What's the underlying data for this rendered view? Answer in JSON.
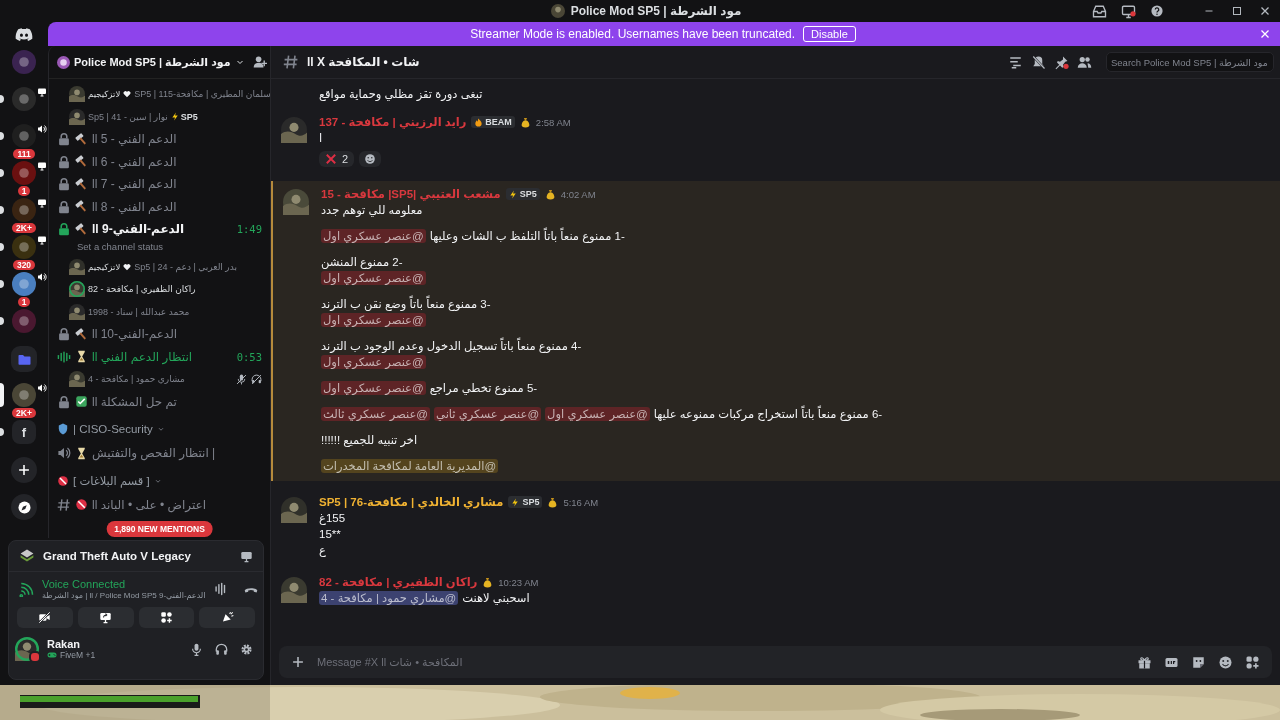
{
  "title_bar": {
    "title": "Police Mod SP5 | مود الشرطة"
  },
  "banner": {
    "text": "Streamer Mode is enabled. Usernames have been truncated.",
    "button": "Disable"
  },
  "rail": {
    "servers": [
      {
        "kind": "server",
        "color": "#3a2350",
        "unread": false,
        "selected": false,
        "voice": false,
        "screen": false
      },
      {
        "kind": "server",
        "color": "#2a2a2a",
        "unread": true,
        "selected": false,
        "voice": false,
        "screen": true
      },
      {
        "kind": "server",
        "color": "#1f1f1f",
        "unread": true,
        "selected": false,
        "voice": true,
        "screen": false,
        "badge": "111"
      },
      {
        "kind": "server",
        "color": "#6a1010",
        "unread": true,
        "selected": false,
        "voice": false,
        "screen": true,
        "badge": "1"
      },
      {
        "kind": "server",
        "color": "#3a2412",
        "unread": true,
        "selected": false,
        "voice": false,
        "screen": true,
        "badge": "2K+"
      },
      {
        "kind": "server",
        "color": "#3a3010",
        "unread": true,
        "selected": false,
        "voice": false,
        "screen": true,
        "badge": "320"
      },
      {
        "kind": "server",
        "color": "#4a7fc0",
        "unread": true,
        "selected": false,
        "voice": true,
        "screen": false,
        "badge": "1"
      },
      {
        "kind": "server",
        "color": "#4a1830",
        "unread": true,
        "selected": false,
        "voice": false,
        "screen": false
      },
      {
        "kind": "folder"
      },
      {
        "kind": "server",
        "color": "#4a4636",
        "unread": false,
        "selected": true,
        "voice": true,
        "screen": false,
        "badge": "2K+"
      },
      {
        "kind": "server",
        "color": "#232428",
        "unread": true,
        "selected": false,
        "voice": false,
        "screen": false,
        "label": "f"
      },
      {
        "kind": "add"
      },
      {
        "kind": "discover"
      }
    ]
  },
  "sidebar": {
    "server_name": "Police Mod SP5 | مود الشرطة",
    "items": [
      {
        "kind": "user",
        "name": "سلمان المطيري | مكافحة-115 | SP5",
        "note": "لاتزكيجيم",
        "speaking": false,
        "muted": false
      },
      {
        "kind": "user",
        "name": "نوار | سين - 41 | Sp5",
        "tag": "SP5",
        "speaking": false,
        "muted": false
      },
      {
        "kind": "voice",
        "locked": true,
        "live": false,
        "name": "الدعم الفني - 5 ll",
        "active": false
      },
      {
        "kind": "voice",
        "locked": true,
        "live": false,
        "name": "الدعم الفني - 6 ll",
        "active": false
      },
      {
        "kind": "voice",
        "locked": true,
        "live": false,
        "name": "الدعم الفني - 7 ll",
        "active": false
      },
      {
        "kind": "voice",
        "locked": true,
        "live": false,
        "name": "الدعم الفني - 8 ll",
        "active": false
      },
      {
        "kind": "voice",
        "locked": true,
        "live": false,
        "name": "الدعم-الفني-9 ll",
        "active": true,
        "time": "1:49",
        "status": "Set a channel status"
      },
      {
        "kind": "user",
        "name": "بدر العربي | دعم - 24 | Sp5",
        "note": "لاتزكيجيم",
        "speaking": false,
        "muted": false
      },
      {
        "kind": "user",
        "name": "راكان الظفيري | مكافحة - 82",
        "speaking": true,
        "muted": false
      },
      {
        "kind": "user",
        "name": "محمد عبدالله | سناد - 1998",
        "speaking": false,
        "muted": false
      },
      {
        "kind": "voice",
        "locked": true,
        "live": false,
        "name": "الدعم-الفني-10 ll",
        "active": false
      },
      {
        "kind": "voice",
        "locked": false,
        "live": true,
        "name": "انتظار الدعم الفني ll",
        "active": false,
        "time": "0:53"
      },
      {
        "kind": "user",
        "name": "مشاري حمود | مكافحة - 4",
        "speaking": false,
        "muted": true
      },
      {
        "kind": "voice",
        "locked": true,
        "live": false,
        "name": "تم حل المشكلة ll",
        "active": false
      },
      {
        "kind": "category",
        "name": "| CISO-Security"
      },
      {
        "kind": "voice",
        "locked": false,
        "live": false,
        "name": "| انتظار الفحص والتفتيش",
        "active": false
      },
      {
        "kind": "category",
        "name": "[ قسم البلاغات ]"
      },
      {
        "kind": "text",
        "locked": false,
        "live": false,
        "name": "اعتراض • على • الباند ll",
        "active": false
      }
    ],
    "mentions_badge": "1,890 NEW MENTIONS"
  },
  "activity": {
    "game": "Grand Theft Auto V Legacy"
  },
  "voice": {
    "status": "Voice Connected",
    "location": "الدعم-الفني-9 ll / Police Mod SP5 | مود الشرطة"
  },
  "user": {
    "name": "Rakan",
    "activity": "FiveM +1",
    "do_not_disturb": true
  },
  "chat": {
    "channel": "شات • المكافحة ll X",
    "search_placeholder": "Search Police Mod SP5 | مود الشرطة",
    "messages": [
      {
        "kind": "continuation",
        "blocks": [
          {
            "text": "تبغى دورة تقز مظلي وحماية مواقع"
          }
        ]
      },
      {
        "kind": "message",
        "author": "رايد الرزيني | مكافحة - 137",
        "color": "#d9383e",
        "tag": {
          "kind": "fire",
          "label": "BEAM"
        },
        "time": "2:58 AM",
        "highlighted": false,
        "blocks": [
          {
            "text": "ا"
          }
        ],
        "reactions": [
          {
            "count": "2"
          }
        ]
      },
      {
        "kind": "message",
        "author": "مشعب العتيبي |SP5| مكافحة - 15",
        "color": "#d9383e",
        "tag": {
          "kind": "bolt",
          "label": "SP5"
        },
        "time": "4:02 AM",
        "highlighted": true,
        "blocks": [
          {
            "text": "معلومه للي توهم جدد"
          },
          {
            "text": "-1 ممنوع منعاً باتاً التلفظ ب الشات وعليها",
            "mentions": [
              {
                "text": "@عنصر عسكري اول",
                "color": "#5e2426"
              }
            ],
            "mentions_below": false
          },
          {
            "text": "-2 ممنوع المنشن",
            "mentions": [
              {
                "text": "@عنصر عسكري اول",
                "color": "#5e2426"
              }
            ],
            "mentions_below": true
          },
          {
            "text": "-3 ممنوع منعاً باتاً وضع نقن ب الترند",
            "mentions": [
              {
                "text": "@عنصر عسكري اول",
                "color": "#5e2426"
              }
            ],
            "mentions_below": true
          },
          {
            "text": "-4 ممنوع منعاً باتاً تسجيل الدخول وعدم الوجود ب الترند",
            "mentions": [
              {
                "text": "@عنصر عسكري اول",
                "color": "#5e2426"
              }
            ],
            "mentions_below": true
          },
          {
            "text": "-5 ممنوع تخطي مراجع",
            "mentions": [
              {
                "text": "@عنصر عسكري اول",
                "color": "#5e2426"
              }
            ],
            "mentions_below": false
          },
          {
            "text": "-6 ممنوع منعاً باتاً استخراج مركبات ممنوعه عليها",
            "mentions": [
              {
                "text": "@عنصر عسكري اول",
                "color": "#5e2426"
              },
              {
                "text": "@عنصر عسكري ثاني",
                "color": "#5e2426"
              },
              {
                "text": "@عنصر عسكري ثالث",
                "color": "#5e2426"
              }
            ],
            "mentions_below": false
          },
          {
            "text": "اخر تنبيه للجميع !!!!!!"
          },
          {
            "mentions": [
              {
                "text": "@المديرية العامة لمكافحة المخدرات",
                "color": "#54441e"
              }
            ],
            "mentions_below": false
          }
        ]
      },
      {
        "kind": "message",
        "author": "مشاري الخالدي | مكافحة-76 | SP5",
        "color": "#f0b232",
        "tag": {
          "kind": "bolt",
          "label": "SP5"
        },
        "time": "5:16 AM",
        "highlighted": false,
        "blocks": [
          {
            "text": "155غ"
          },
          {
            "text": "15**"
          },
          {
            "text": "ع"
          }
        ]
      },
      {
        "kind": "message",
        "author": "راكان الظفيري | مكافحة - 82",
        "color": "#d9383e",
        "time": "10:23 AM",
        "highlighted": false,
        "blocks": [
          {
            "text": "اسحبني لاهنت",
            "mentions": [
              {
                "text": "@مشاري حمود | مكافحة - 4",
                "color": "#3c4270"
              }
            ],
            "mentions_below": false
          }
        ]
      }
    ],
    "composer_placeholder": "Message #X ll المكافحة • شات"
  }
}
